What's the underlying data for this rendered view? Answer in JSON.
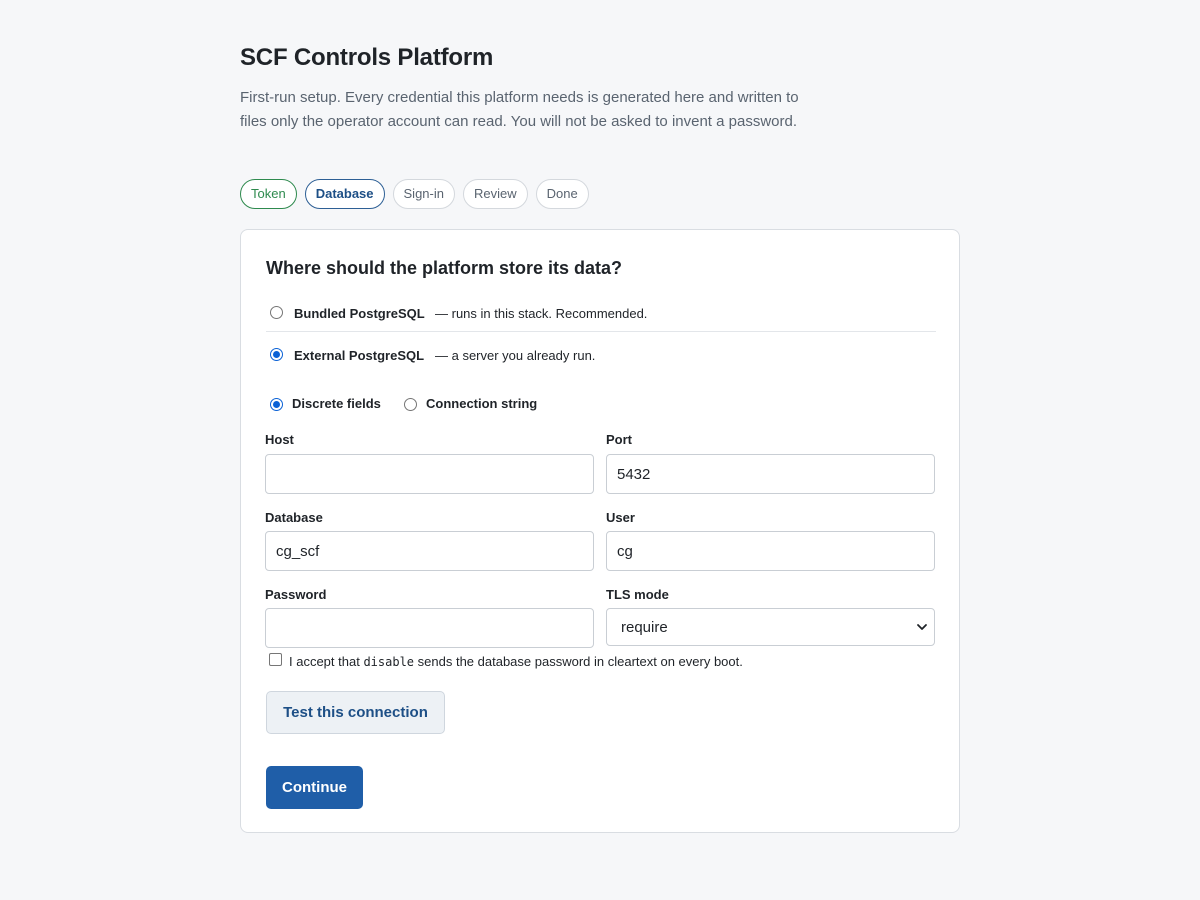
{
  "app": {
    "title": "SCF Controls Platform",
    "intro": "First-run setup. Every credential this platform needs is generated here and written to files only the operator account can read. You will not be asked to invent a password."
  },
  "steps": [
    {
      "label": "Token",
      "state": "done"
    },
    {
      "label": "Database",
      "state": "active"
    },
    {
      "label": "Sign-in",
      "state": "pending"
    },
    {
      "label": "Review",
      "state": "pending"
    },
    {
      "label": "Done",
      "state": "pending"
    }
  ],
  "database": {
    "heading": "Where should the platform store its data?",
    "options": [
      {
        "label": "Bundled PostgreSQL",
        "description": "— runs in this stack. Recommended.",
        "selected": false
      },
      {
        "label": "External PostgreSQL",
        "description": "— a server you already run.",
        "selected": true
      }
    ],
    "modes": [
      {
        "label": "Discrete fields",
        "selected": true
      },
      {
        "label": "Connection string",
        "selected": false
      }
    ],
    "fields": {
      "host": {
        "label": "Host",
        "value": ""
      },
      "port": {
        "label": "Port",
        "value": "5432"
      },
      "database": {
        "label": "Database",
        "value": "cg_scf"
      },
      "user": {
        "label": "User",
        "value": "cg"
      },
      "password": {
        "label": "Password",
        "value": ""
      },
      "tls": {
        "label": "TLS mode",
        "value": "require"
      }
    },
    "accept": {
      "prefix": "I accept that",
      "code": "disable",
      "suffix": "sends the database password in cleartext on every boot.",
      "checked": false
    },
    "test_button": "Test this connection",
    "continue_button": "Continue"
  },
  "colors": {
    "accent": "#1f5ea8",
    "step_done": "#2e8a4e",
    "step_active": "#1d4f86",
    "radio_selected": "#0b62d6",
    "background": "#f6f7f9"
  }
}
